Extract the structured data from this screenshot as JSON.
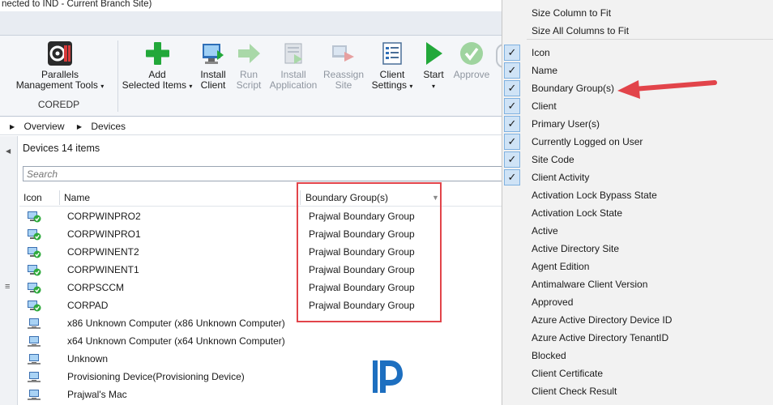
{
  "window": {
    "title": "nected to IND - Current Branch Site)"
  },
  "ribbon": {
    "parallels_label_1": "Parallels",
    "parallels_label_2": "Management Tools",
    "group_caption": "COREDP",
    "add_1": "Add",
    "add_2": "Selected Items",
    "install_client_1": "Install",
    "install_client_2": "Client",
    "run_script_1": "Run",
    "run_script_2": "Script",
    "install_app_1": "Install",
    "install_app_2": "Application",
    "reassign_1": "Reassign",
    "reassign_2": "Site",
    "client_settings_1": "Client",
    "client_settings_2": "Settings",
    "start_1": "Start",
    "approve_1": "Approve",
    "dropdown_glyph": "▾"
  },
  "breadcrumb": {
    "items": [
      "Overview",
      "Devices"
    ],
    "separator": "▶"
  },
  "devices": {
    "header": "Devices 14 items",
    "search_placeholder": "Search"
  },
  "table": {
    "columns": [
      "Icon",
      "Name",
      "Boundary Group(s)"
    ],
    "rows": [
      {
        "name": "CORPWINPRO2",
        "boundary_group": "Prajwal Boundary Group",
        "client": true
      },
      {
        "name": "CORPWINPRO1",
        "boundary_group": "Prajwal Boundary Group",
        "client": true
      },
      {
        "name": "CORPWINENT2",
        "boundary_group": "Prajwal Boundary Group",
        "client": true
      },
      {
        "name": "CORPWINENT1",
        "boundary_group": "Prajwal Boundary Group",
        "client": true
      },
      {
        "name": "CORPSCCM",
        "boundary_group": "Prajwal Boundary Group",
        "client": true
      },
      {
        "name": "CORPAD",
        "boundary_group": "Prajwal Boundary Group",
        "client": true
      },
      {
        "name": "x86 Unknown Computer (x86 Unknown Computer)",
        "boundary_group": "",
        "client": false
      },
      {
        "name": "x64 Unknown Computer (x64 Unknown Computer)",
        "boundary_group": "",
        "client": false
      },
      {
        "name": "Unknown",
        "boundary_group": "",
        "client": false
      },
      {
        "name": "Provisioning Device(Provisioning Device)",
        "boundary_group": "",
        "client": false
      },
      {
        "name": "Prajwal's Mac",
        "boundary_group": "",
        "client": false
      }
    ]
  },
  "context_menu": {
    "top_items": [
      "Size Column to Fit",
      "Size All Columns to Fit"
    ],
    "column_items": [
      {
        "label": "Icon",
        "checked": true
      },
      {
        "label": "Name",
        "checked": true
      },
      {
        "label": "Boundary Group(s)",
        "checked": true
      },
      {
        "label": "Client",
        "checked": true
      },
      {
        "label": "Primary User(s)",
        "checked": true
      },
      {
        "label": "Currently Logged on User",
        "checked": true
      },
      {
        "label": "Site Code",
        "checked": true
      },
      {
        "label": "Client Activity",
        "checked": true
      },
      {
        "label": "Activation Lock Bypass State",
        "checked": false
      },
      {
        "label": "Activation Lock State",
        "checked": false
      },
      {
        "label": "Active",
        "checked": false
      },
      {
        "label": "Active Directory Site",
        "checked": false
      },
      {
        "label": "Agent Edition",
        "checked": false
      },
      {
        "label": "Antimalware Client Version",
        "checked": false
      },
      {
        "label": "Approved",
        "checked": false
      },
      {
        "label": "Azure Active Directory Device ID",
        "checked": false
      },
      {
        "label": "Azure Active Directory TenantID",
        "checked": false
      },
      {
        "label": "Blocked",
        "checked": false
      },
      {
        "label": "Client Certificate",
        "checked": false
      },
      {
        "label": "Client Check Result",
        "checked": false
      }
    ],
    "check_glyph": "✓"
  },
  "colors": {
    "highlight_red": "#e2444a",
    "check_blue": "#cfe3f6",
    "green_add": "#22a83a",
    "logo_blue": "#1d6fc0"
  }
}
